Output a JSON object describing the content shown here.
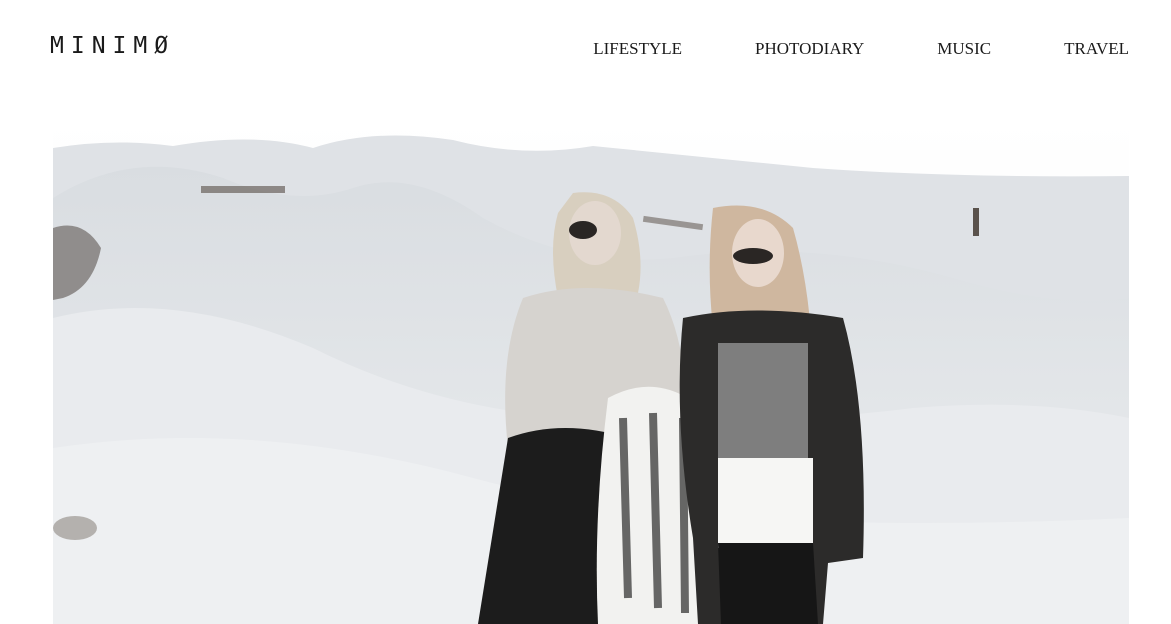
{
  "header": {
    "logo": "MINIMØ",
    "nav": [
      {
        "label": "LIFESTYLE"
      },
      {
        "label": "PHOTODIARY"
      },
      {
        "label": "MUSIC"
      },
      {
        "label": "TRAVEL"
      }
    ]
  },
  "hero": {
    "image": "two-women-on-snowy-dunes-photo"
  },
  "colors": {
    "text": "#1a1a1a",
    "background": "#ffffff",
    "snow": "#e6e9ec"
  }
}
